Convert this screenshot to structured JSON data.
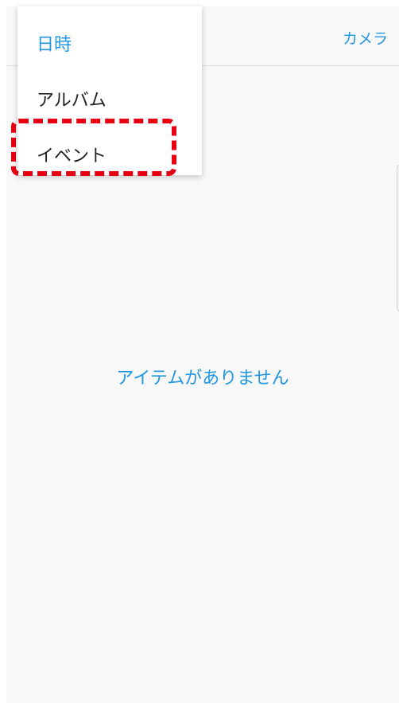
{
  "header": {
    "camera_tab_label": "カメラ"
  },
  "dropdown": {
    "items": [
      {
        "label": "日時",
        "selected": true
      },
      {
        "label": "アルバム",
        "selected": false
      },
      {
        "label": "イベント",
        "selected": false
      }
    ],
    "selected_color": "#2196e3"
  },
  "main": {
    "empty_message": "アイテムがありません"
  },
  "annotation": {
    "highlight_color": "#e60012",
    "highlighted_item": "イベント"
  }
}
